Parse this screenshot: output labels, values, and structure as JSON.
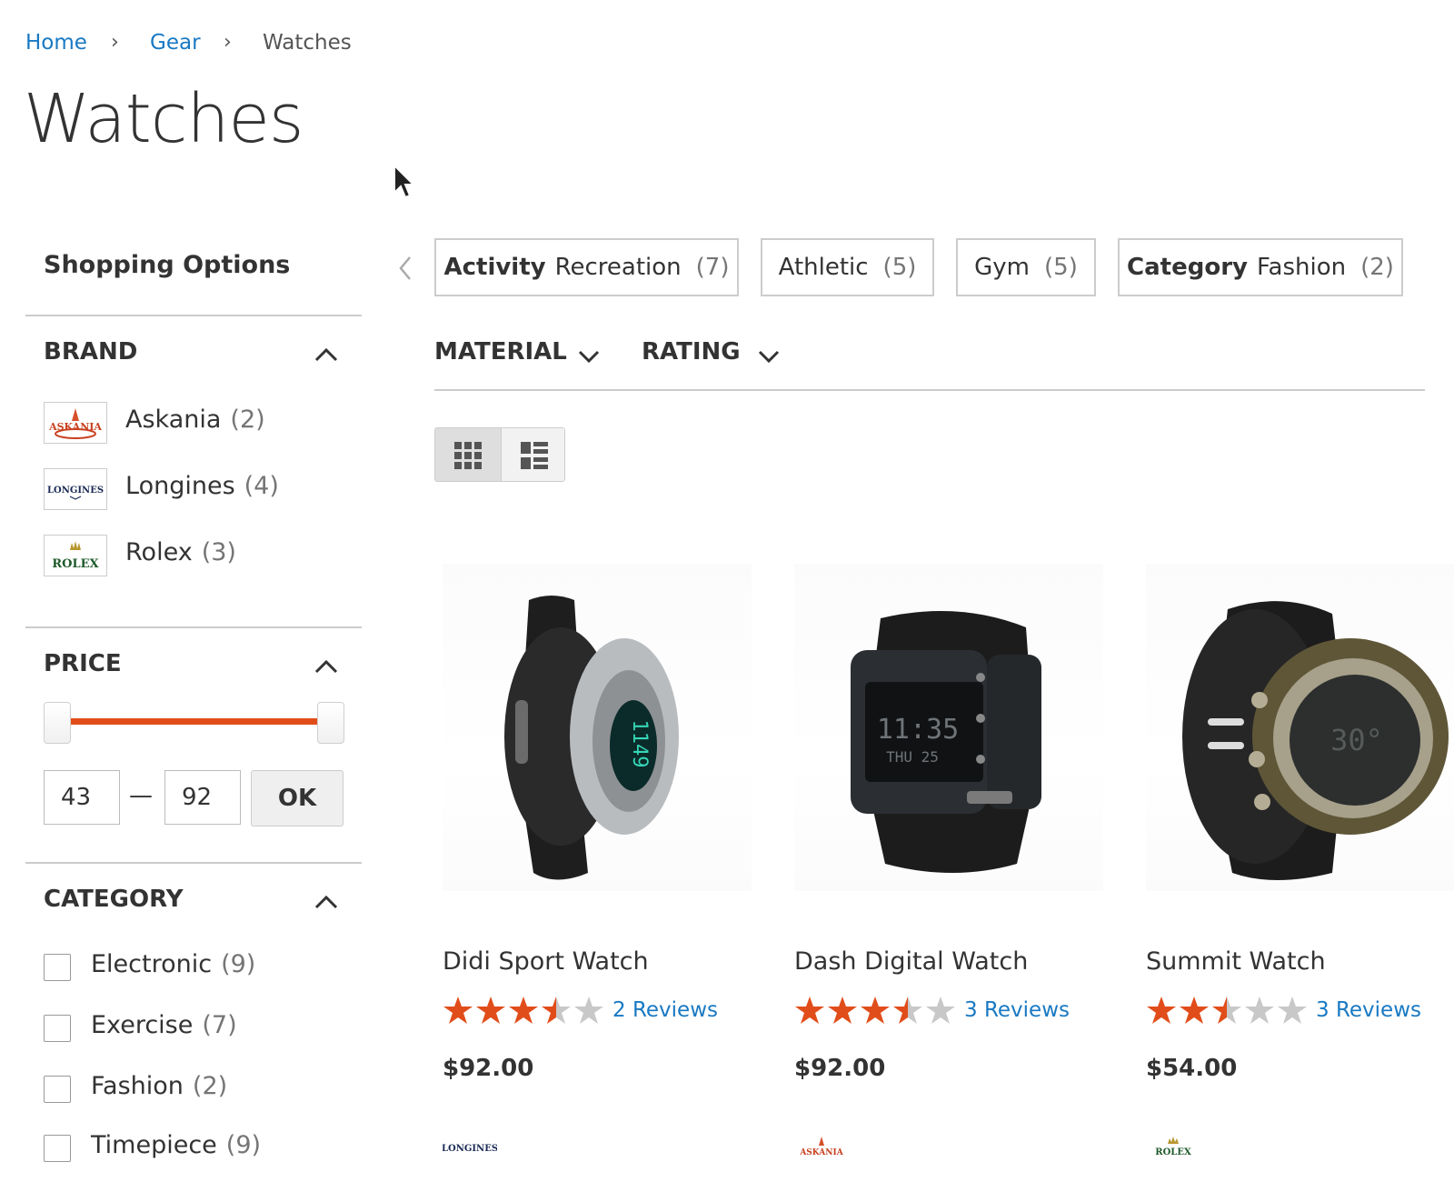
{
  "breadcrumb": {
    "home": "Home",
    "gear": "Gear",
    "current": "Watches"
  },
  "page_title": "Watches",
  "sidebar": {
    "title": "Shopping Options",
    "brand": {
      "title": "BRAND",
      "items": [
        {
          "label": "Askania",
          "count": "(2)",
          "logo_text": "ASKANIA"
        },
        {
          "label": "Longines",
          "count": "(4)",
          "logo_text": "LONGINES"
        },
        {
          "label": "Rolex",
          "count": "(3)",
          "logo_text": "ROLEX"
        }
      ]
    },
    "price": {
      "title": "PRICE",
      "min": "43",
      "max": "92",
      "dash": "—",
      "ok_label": "OK"
    },
    "category": {
      "title": "CATEGORY",
      "items": [
        {
          "label": "Electronic",
          "count": "(9)"
        },
        {
          "label": "Exercise",
          "count": "(7)"
        },
        {
          "label": "Fashion",
          "count": "(2)"
        },
        {
          "label": "Timepiece",
          "count": "(9)"
        }
      ]
    }
  },
  "swatches": [
    {
      "attribute": "Activity",
      "label": "Recreation",
      "count": "(7)"
    },
    {
      "attribute": "",
      "label": "Athletic",
      "count": "(5)"
    },
    {
      "attribute": "",
      "label": "Gym",
      "count": "(5)"
    },
    {
      "attribute": "Category",
      "label": "Fashion",
      "count": "(2)"
    }
  ],
  "filters": {
    "material": "MATERIAL",
    "rating": "RATING"
  },
  "products": [
    {
      "name": "Didi Sport Watch",
      "rating_percent": 70,
      "reviews": "2 Reviews",
      "price": "$92.00",
      "brand_logo_text": "LONGINES"
    },
    {
      "name": "Dash Digital Watch",
      "rating_percent": 70,
      "reviews": "3 Reviews",
      "price": "$92.00",
      "brand_logo_text": "ASKANIA"
    },
    {
      "name": "Summit Watch",
      "rating_percent": 50,
      "reviews": "3 Reviews",
      "price": "$54.00",
      "brand_logo_text": "ROLEX"
    }
  ],
  "colors": {
    "accent": "#e14d1a",
    "link": "#1979c3",
    "star": "#e14d1a",
    "star_empty": "#c8c8c8"
  }
}
